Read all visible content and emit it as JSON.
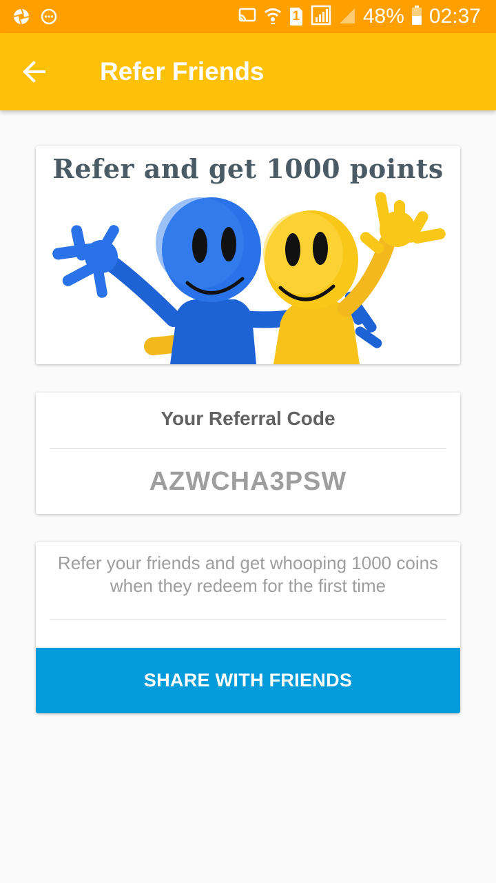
{
  "status_bar": {
    "battery_percent": "48%",
    "time": "02:37",
    "sim_slot": "1",
    "icons": [
      "camera-aperture-icon",
      "chat-bubble-icon",
      "cast-icon",
      "wifi-icon",
      "sim-1-icon",
      "signal-icon",
      "signal-empty-icon",
      "battery-icon"
    ]
  },
  "app_bar": {
    "title": "Refer Friends",
    "back_icon": "arrow-back-icon",
    "background": "#FFC107"
  },
  "banner": {
    "headline": "Refer and get 1000 points",
    "image": "blue and yellow smiley figurines waving"
  },
  "referral": {
    "label": "Your Referral Code",
    "code": "AZWCHA3PSW"
  },
  "share": {
    "description": "Refer your friends and get whooping 1000 coins when they redeem for the first time",
    "button_label": "SHARE WITH FRIENDS",
    "button_color": "#039BD9"
  },
  "colors": {
    "status_bar": "#FFA000",
    "app_bar": "#FFC107",
    "accent": "#039BD9"
  }
}
